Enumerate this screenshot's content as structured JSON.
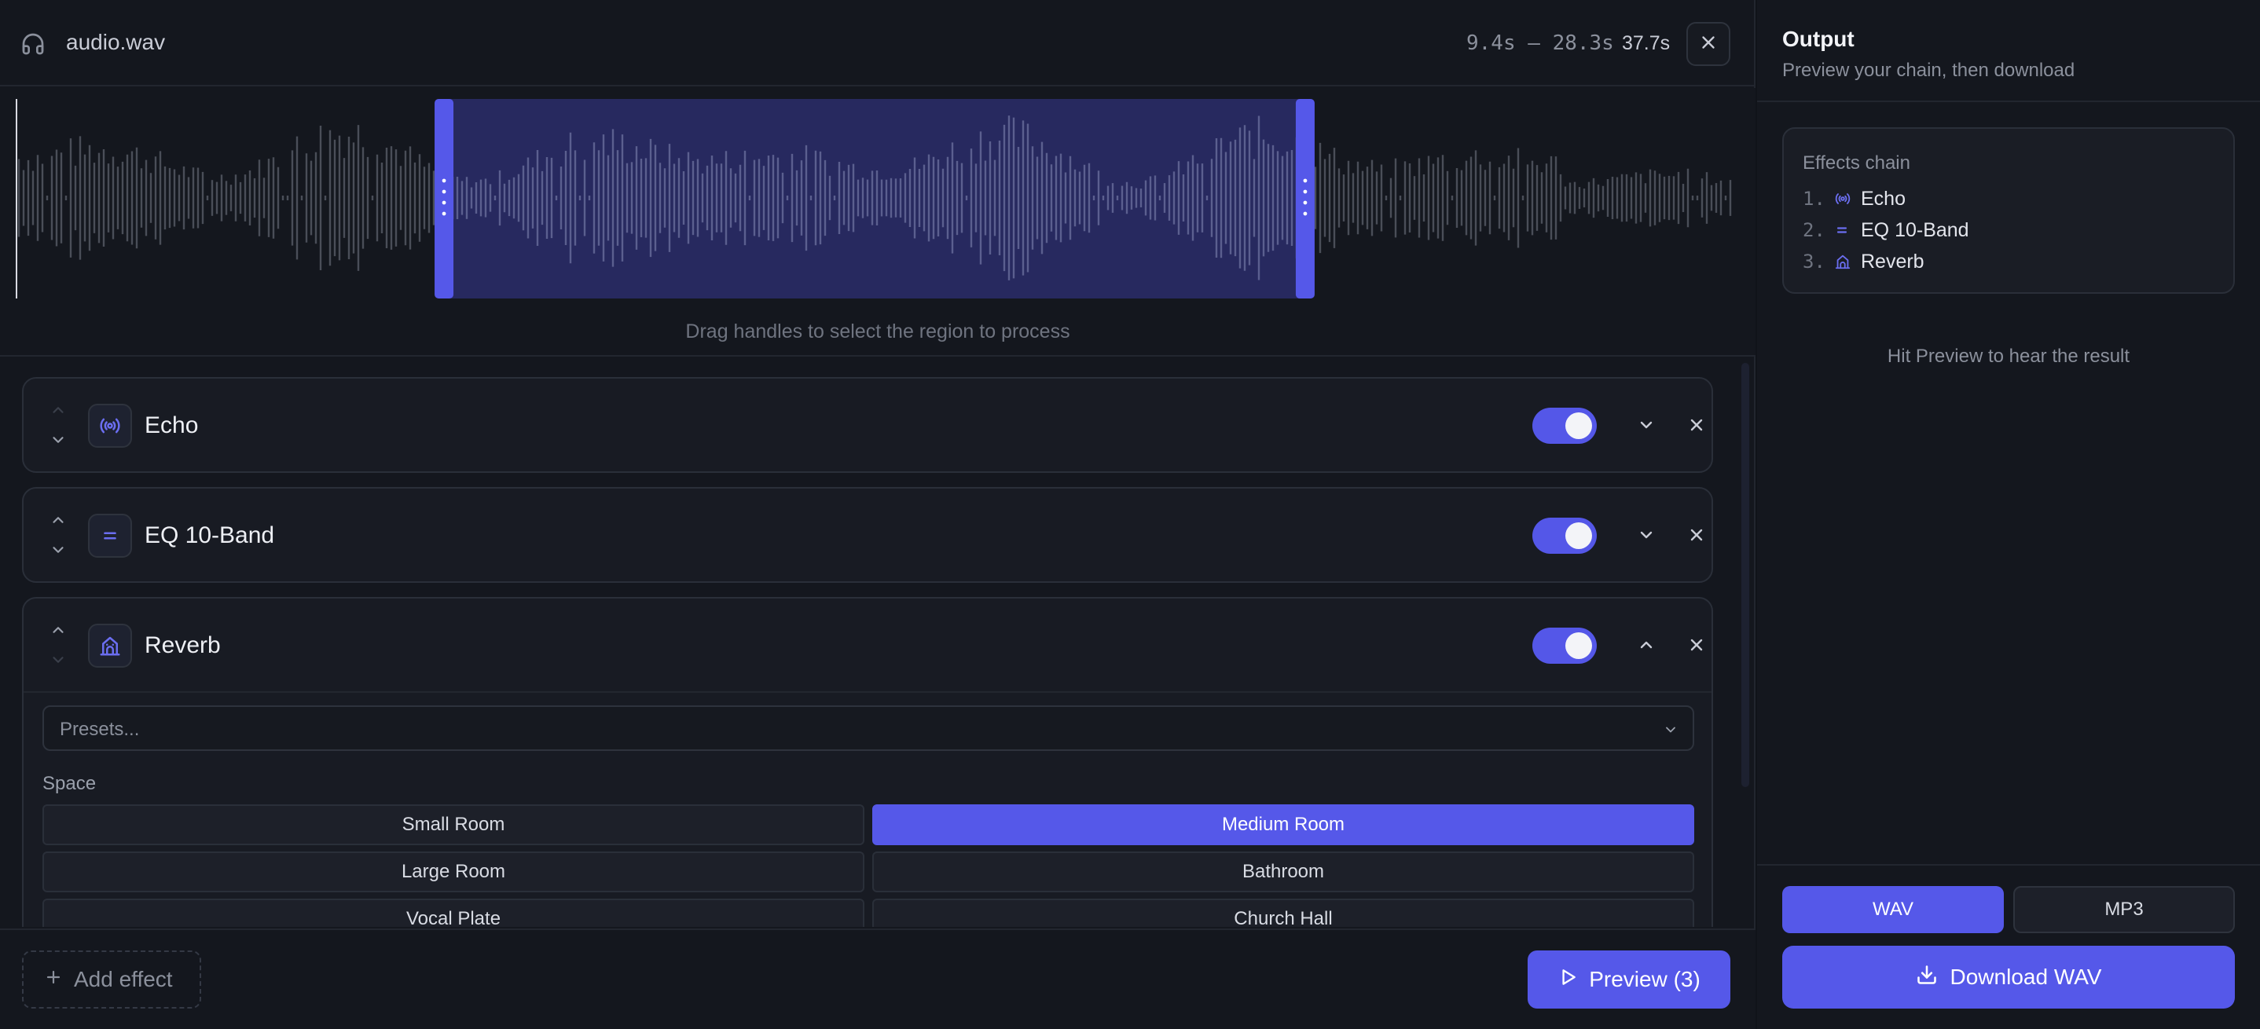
{
  "header": {
    "file_name": "audio.wav",
    "file_icon": "headphones-icon",
    "selection_range": "9.4s – 28.3s",
    "duration": "37.7s",
    "close_icon": "close-icon"
  },
  "waveform": {
    "hint": "Drag handles to select the region to process",
    "selection_start_s": 9.4,
    "selection_end_s": 28.3,
    "total_s": 37.7,
    "accent": "#5558e9"
  },
  "effects": [
    {
      "name": "Echo",
      "icon": "broadcast-icon",
      "enabled": true,
      "expanded": false
    },
    {
      "name": "EQ 10-Band",
      "icon": "equals-icon",
      "enabled": true,
      "expanded": false
    },
    {
      "name": "Reverb",
      "icon": "building-icon",
      "enabled": true,
      "expanded": true
    }
  ],
  "reverb": {
    "presets_placeholder": "Presets...",
    "space_label": "Space",
    "spaces": [
      "Small Room",
      "Medium Room",
      "Large Room",
      "Bathroom",
      "Vocal Plate",
      "Church Hall"
    ],
    "selected_space": "Medium Room"
  },
  "footer": {
    "add_effect": "Add effect",
    "preview": "Preview (3)"
  },
  "output": {
    "title": "Output",
    "subtitle": "Preview your chain, then download",
    "chain_title": "Effects chain",
    "chain": [
      {
        "num": "1.",
        "name": "Echo",
        "icon": "broadcast-icon"
      },
      {
        "num": "2.",
        "name": "EQ 10-Band",
        "icon": "equals-icon"
      },
      {
        "num": "3.",
        "name": "Reverb",
        "icon": "building-icon"
      }
    ],
    "hint": "Hit Preview to hear the result",
    "formats": [
      "WAV",
      "MP3"
    ],
    "selected_format": "WAV",
    "download": "Download WAV"
  },
  "colors": {
    "background": "#101319",
    "panel": "#14171e",
    "card": "#181b23",
    "accent": "#5558e9",
    "text": "#e6e8ee",
    "muted": "#8b909c"
  }
}
